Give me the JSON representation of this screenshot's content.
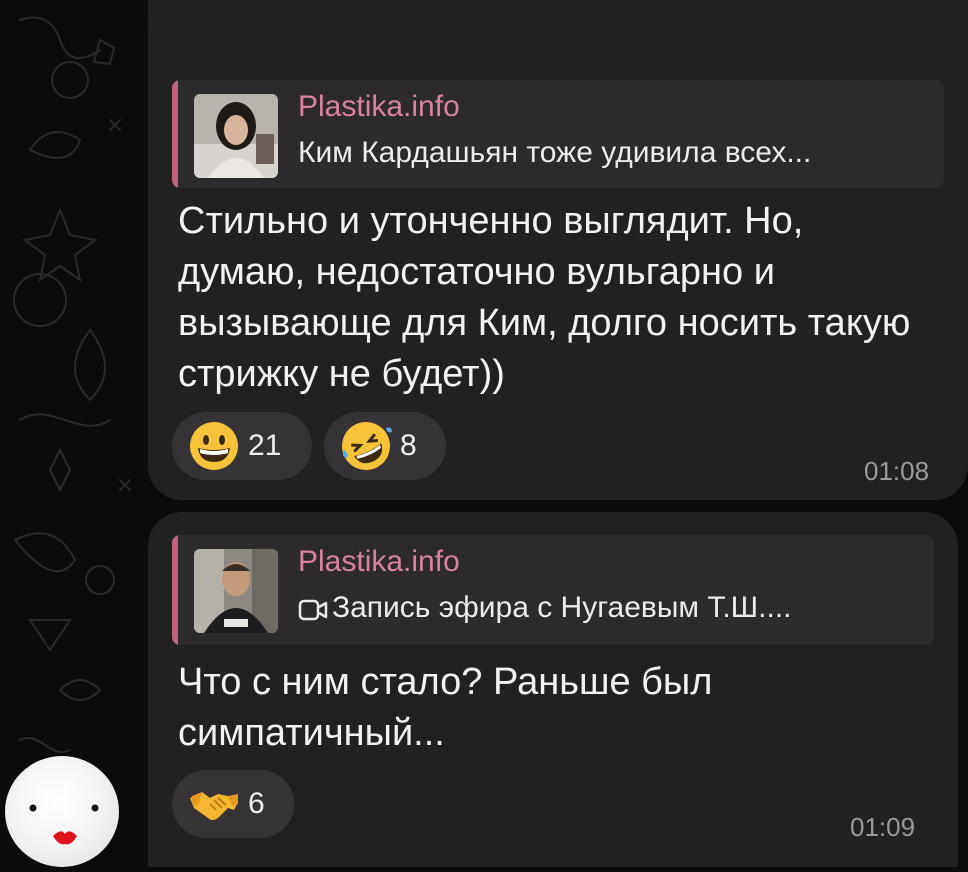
{
  "messages": [
    {
      "reply": {
        "channel": "Plastika.info",
        "text": "Ким Кардашьян тоже удивила всех..."
      },
      "text": "Стильно и утонченно выглядит. Но, думаю, недостаточно вульгарно и вызывающе для Ким, долго носить такую стрижку не будет))",
      "reactions": [
        {
          "emoji": "grinning-face",
          "count": "21"
        },
        {
          "emoji": "rolling-on-floor-laughing",
          "count": "8"
        }
      ],
      "time": "01:08"
    },
    {
      "reply": {
        "channel": "Plastika.info",
        "text": "Запись эфира с Нугаевым Т.Ш...."
      },
      "text": "Что с ним стало? Раньше был симпатичный...",
      "reactions": [
        {
          "emoji": "handshake",
          "count": "6"
        }
      ],
      "time": "01:09"
    }
  ],
  "colors": {
    "background": "#0b0b0c",
    "bubble": "#212121",
    "reply_bar": "#c0647e",
    "reply_name": "#d8849e",
    "reaction": "#353336"
  }
}
